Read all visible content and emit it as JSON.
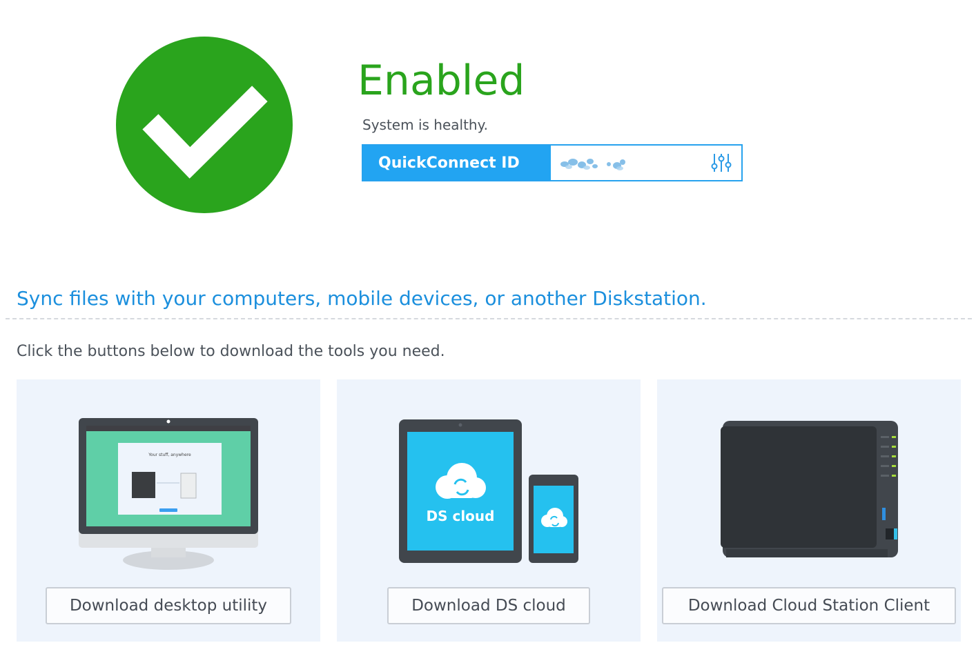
{
  "status": {
    "title": "Enabled",
    "description": "System is healthy.",
    "icon": "check-circle-icon",
    "color": "#2aa41d"
  },
  "quickconnect": {
    "label": "QuickConnect ID",
    "settings_icon": "sliders-icon",
    "accent_color": "#22a4f2"
  },
  "sync": {
    "heading": "Sync files with your computers, mobile devices, or another Diskstation.",
    "instruction": "Click the buttons below to download the tools you need."
  },
  "cards": [
    {
      "illustration": "desktop-monitor-icon",
      "screen_title": "Your stuff, anywhere",
      "button_label": "Download desktop utility"
    },
    {
      "illustration": "tablet-phone-icon",
      "app_name": "DS cloud",
      "button_label": "Download DS cloud"
    },
    {
      "illustration": "nas-device-icon",
      "button_label": "Download Cloud Station Client"
    }
  ]
}
